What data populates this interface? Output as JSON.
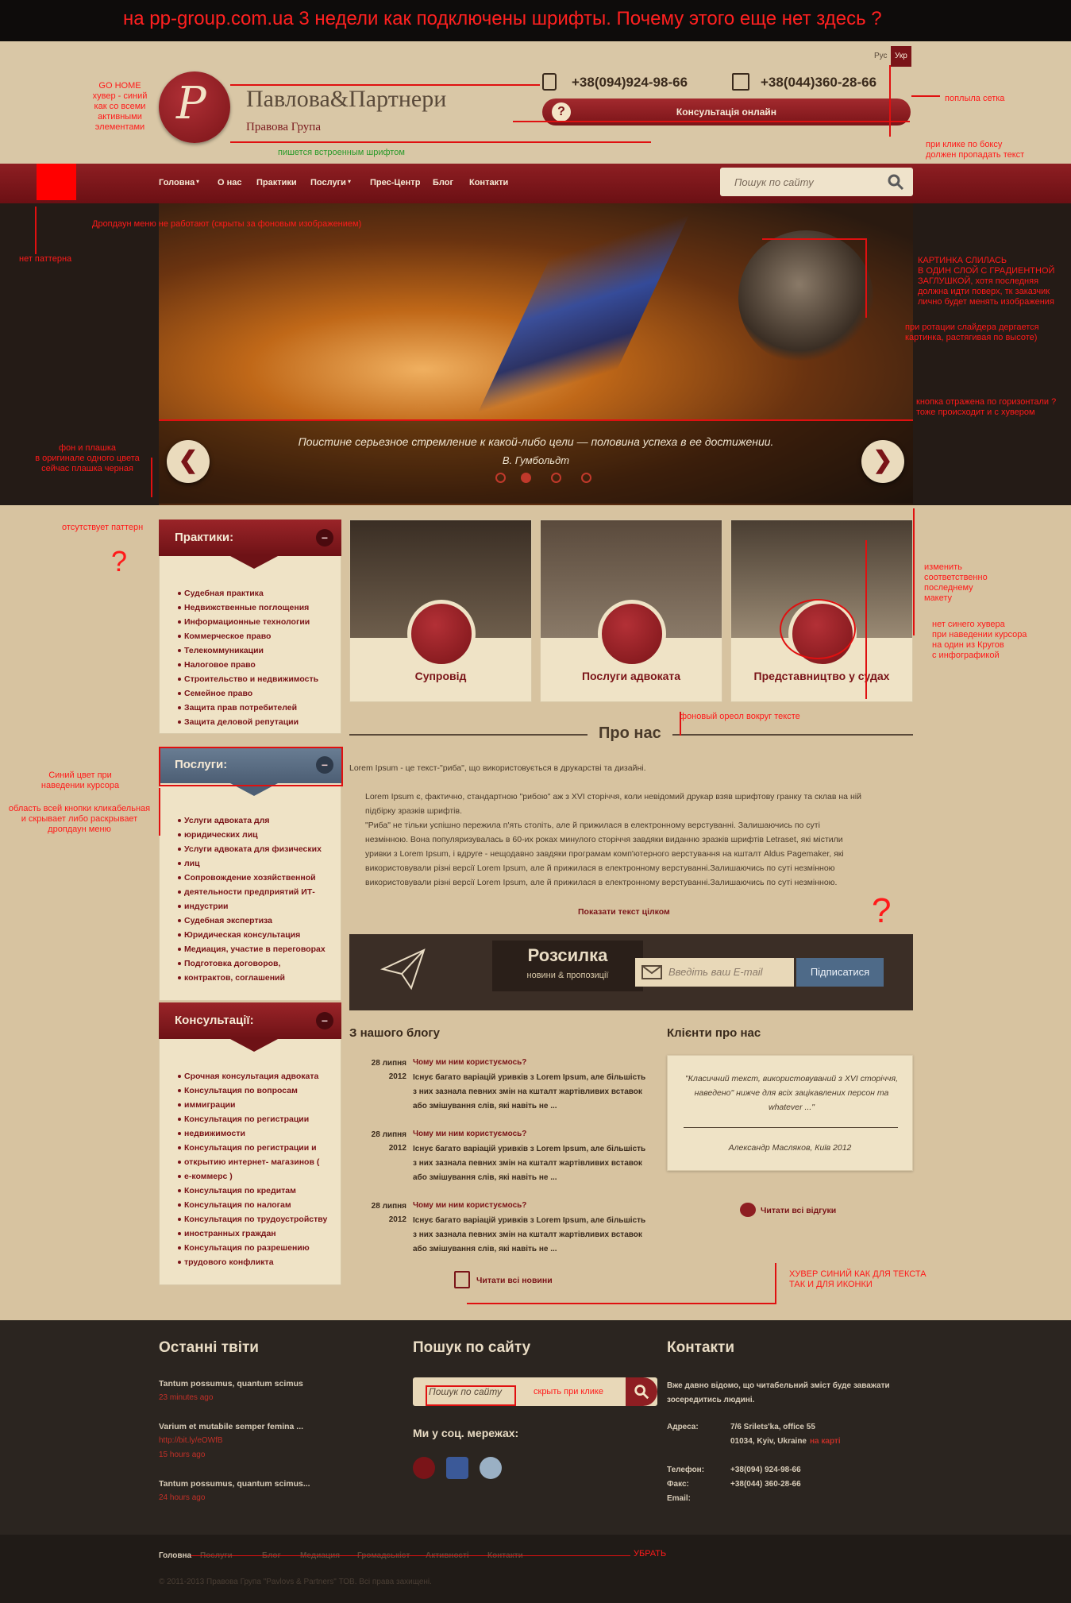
{
  "banner": "на pp-group.com.ua 3 недели как подключены шрифты. Почему этого еще нет здесь ?",
  "header": {
    "lang_ru": "Рус",
    "lang_ua": "Укр",
    "brand": "Павлова&Партнери",
    "subbrand": "Правова Група",
    "logo_letter": "P",
    "phone_mobile": "+38(094)924-98-66",
    "phone_office": "+38(044)360-28-66",
    "consult_label": "Консультація онлайн"
  },
  "nav": {
    "items": [
      "Головна",
      "О нас",
      "Практики",
      "Послуги",
      "Прес-Центр",
      "Блог",
      "Контакти"
    ],
    "search_placeholder": "Пошук по сайту"
  },
  "slider": {
    "quote": "Поистине серьезное стремление к какой-либо цели — половина успеха в ее достижении.",
    "author": "В. Гумбольдт",
    "prev": "❮",
    "next": "❯",
    "active_dot": 2,
    "dot_count": 4
  },
  "sidebar": {
    "practices": {
      "title": "Практики:",
      "items": [
        "Судебная практика",
        "Недвижственные поглощения",
        "Информационные технологии",
        "Коммерческое право",
        "Телекоммуникации",
        "Налоговое право",
        "Строительство и недвижимость",
        "Семейное право",
        "Защита прав потребителей",
        "Защита деловой репутации"
      ]
    },
    "services": {
      "title": "Послуги:",
      "items": [
        "Услуги адвоката для",
        "юридических лиц",
        "Услуги адвоката для физических",
        "лиц",
        "Сопровождение хозяйственной",
        "деятельности предприятий ИТ-",
        "индустрии",
        "Судебная экспертиза",
        "Юридическая консультация",
        "Медиация, участие в переговорах",
        "Подготовка договоров,",
        "контрактов, соглашений"
      ]
    },
    "consult": {
      "title": "Консультації:",
      "items": [
        "Срочная консультация адвоката",
        "Консультация по вопросам",
        "иммиграции",
        "Консультация по регистрации",
        "недвижимости",
        "Консультация по регистрации и",
        "открытию интернет- магазинов (",
        "е-коммерс )",
        "Консультация по кредитам",
        "Консультация по налогам",
        "Консультация по трудоустройству",
        "иностранных граждан",
        "Консультация по разрешению",
        "трудового конфликта"
      ]
    },
    "collapse": "−"
  },
  "cards": [
    "Супровід",
    "Послуги адвоката",
    "Представництво у судах"
  ],
  "about": {
    "title": "Про нас",
    "intro": "Lorem Ipsum - це текст-\"риба\", що використовується в друкарстві та дизайні.",
    "bullet1_l1": "Lorem Ipsum є, фактично, стандартною \"рибою\" аж з XVI сторіччя, коли невідомий друкар взяв шрифтову гранку та склав на ній",
    "bullet1_l2": "підбірку зразків шрифтів.",
    "bullet2_l1": "\"Риба\" не тільки успішно пережила п'ять століть, але й прижилася в електронному верстуванні. Залишаючись по суті",
    "bullet2_l2": "незмінною. Вона популяризувалась в 60-их роках минулого сторіччя завдяки виданню зразків шрифтів Letraset, які містили",
    "bullet2_l3": "уривки з Lorem Ipsum, і вдруге - нещодавно завдяки програмам комп'ютерного верстування на кшталт Aldus Pagemaker, які",
    "bullet2_l4": "використовували різні версії Lorem Ipsum, але й прижилася в електронному верстуванні.Залишаючись по суті незмінною",
    "bullet2_l5": "використовували різні версії Lorem Ipsum, але й прижилася в електронному верстуванні.Залишаючись по суті незмінною.",
    "more": "Показати текст цілком"
  },
  "newsletter": {
    "title": "Розсилка",
    "subtitle": "новини & пропозиції",
    "placeholder": "Введіть ваш E-mail",
    "button": "Підписатися"
  },
  "blog": {
    "title": "З нашого блогу",
    "posts": [
      {
        "day": "28 липня",
        "year": "2012",
        "title": "Чому ми ним користуємось?",
        "l1": "Існує багато варіацій уривків з Lorem Ipsum, але більшість",
        "l2": "з них зазнала певних змін на кшталт жартівливих вставок",
        "l3": "або змішування слів, які навіть не ..."
      },
      {
        "day": "28 липня",
        "year": "2012",
        "title": "Чому ми ним користуємось?",
        "l1": "Існує багато варіацій уривків з Lorem Ipsum, але більшість",
        "l2": "з них зазнала певних змін на кшталт жартівливих вставок",
        "l3": "або змішування слів, які навіть не ..."
      },
      {
        "day": "28 липня",
        "year": "2012",
        "title": "Чому ми ним користуємось?",
        "l1": "Існує багато варіацій уривків з Lorem Ipsum, але більшість",
        "l2": "з них зазнала певних змін на кшталт жартівливих вставок",
        "l3": "або змішування слів, які навіть не ..."
      }
    ],
    "all": "Читати всі новини"
  },
  "clients": {
    "title": "Клієнти про нас",
    "quote_l1": "\"Класичний текст, використовуваний з XVI сторіччя,",
    "quote_l2": "наведено\" нижче для всіх зацікавлених персон та",
    "quote_l3": "whatever ...\"",
    "author": "Александр Масляков, Київ 2012",
    "all": "Читати всі відгуки"
  },
  "footer": {
    "tweets_title": "Останні твіти",
    "tweets": [
      {
        "text": "Tantum possumus, quantum scimus",
        "time": "23 minutes ago"
      },
      {
        "text": "Varium et mutabile semper femina ...",
        "link": "http://bit.ly/eOWfB",
        "time": "15 hours ago"
      },
      {
        "text": "Tantum possumus, quantum scimus...",
        "time": "24 hours ago"
      }
    ],
    "search_title": "Пошук по сайту",
    "search_placeholder": "Пошук по сайту",
    "social_title": "Ми у соц. мережах:",
    "contacts_title": "Контакти",
    "contacts_text1": "Вже давно відомо, що читабельний зміст буде заважати",
    "contacts_text2": "зосередитись людині.",
    "address_label": "Адреса:",
    "address1": "7/6 Srilets'ka, office 55",
    "address2": "01034, Kyiv, Ukraine",
    "map_link": "на карті",
    "tel_label": "Телефон:",
    "tel": "+38(094) 924-98-66",
    "fax_label": "Факс:",
    "fax": "+38(044) 360-28-66",
    "email_label": "Email:",
    "nav": [
      "Головна",
      "Послуги",
      "Блог",
      "Медиация",
      "Громадськіст",
      "Активності",
      "Контакти"
    ],
    "copyright": "© 2011-2013 Правова Група \"Pavlovs & Partners\" ТОВ. Всі права захищені."
  },
  "annotations": {
    "go_home": [
      "GO HOME",
      "хувер - синий",
      "как со всеми",
      "активными элементами"
    ],
    "grid": "поплыла сетка",
    "font_note": "пишется встроенным шрифтом",
    "search_click": [
      "при клике по боксу",
      "должен пропадать текст"
    ],
    "dropdown": "Дропдаун меню не работают (скрыты за фоновым изображением)",
    "no_pattern": "нет паттерна",
    "picture": [
      "КАРТИНКА СЛИЛАСЬ",
      "В ОДИН СЛОЙ С ГРАДИЕНТНОЙ",
      "ЗАГЛУШКОЙ, хотя последняя",
      "должна идти поверх, тк заказчик",
      "лично будет менять изображения"
    ],
    "rotation": [
      "при ротации слайдера дергается",
      "картинка, растягивая по высоте)"
    ],
    "button_mirror": [
      "кнопка отражена по горизонтали ?",
      "тоже происходит и с хувером"
    ],
    "bg_plate": [
      "фон и плашка",
      "в оригинале одного цвета",
      "сейчас плашка черная"
    ],
    "missing_pattern": "отсутствует паттерн",
    "question": "?",
    "change_last": [
      "изменить",
      "соответственно",
      "последнему",
      "макету"
    ],
    "blue_hover": [
      "нет синего хувера",
      "при наведении курсора",
      "на один из Кругов",
      "с инфографикой"
    ],
    "halo": "фоновый ореол вокруг тексте",
    "blue_color": [
      "Синий цвет при",
      "наведении курсора"
    ],
    "clickable_area": [
      "область всей кнопки кликабельная",
      "и скрывает либо раскрывает",
      "дропдаун меню"
    ],
    "hover_blue": [
      "ХУВЕР СИНИЙ КАК ДЛЯ ТЕКСТА",
      "ТАК И ДЛЯ ИКОНКИ"
    ],
    "hide_click": "скрыть при клике",
    "remove": "УБРАТЬ"
  },
  "colors": {
    "accent": "#7a1418",
    "background": "#d7c3a0",
    "annotation": "#e01010",
    "subscribe": "#4e6a88"
  }
}
